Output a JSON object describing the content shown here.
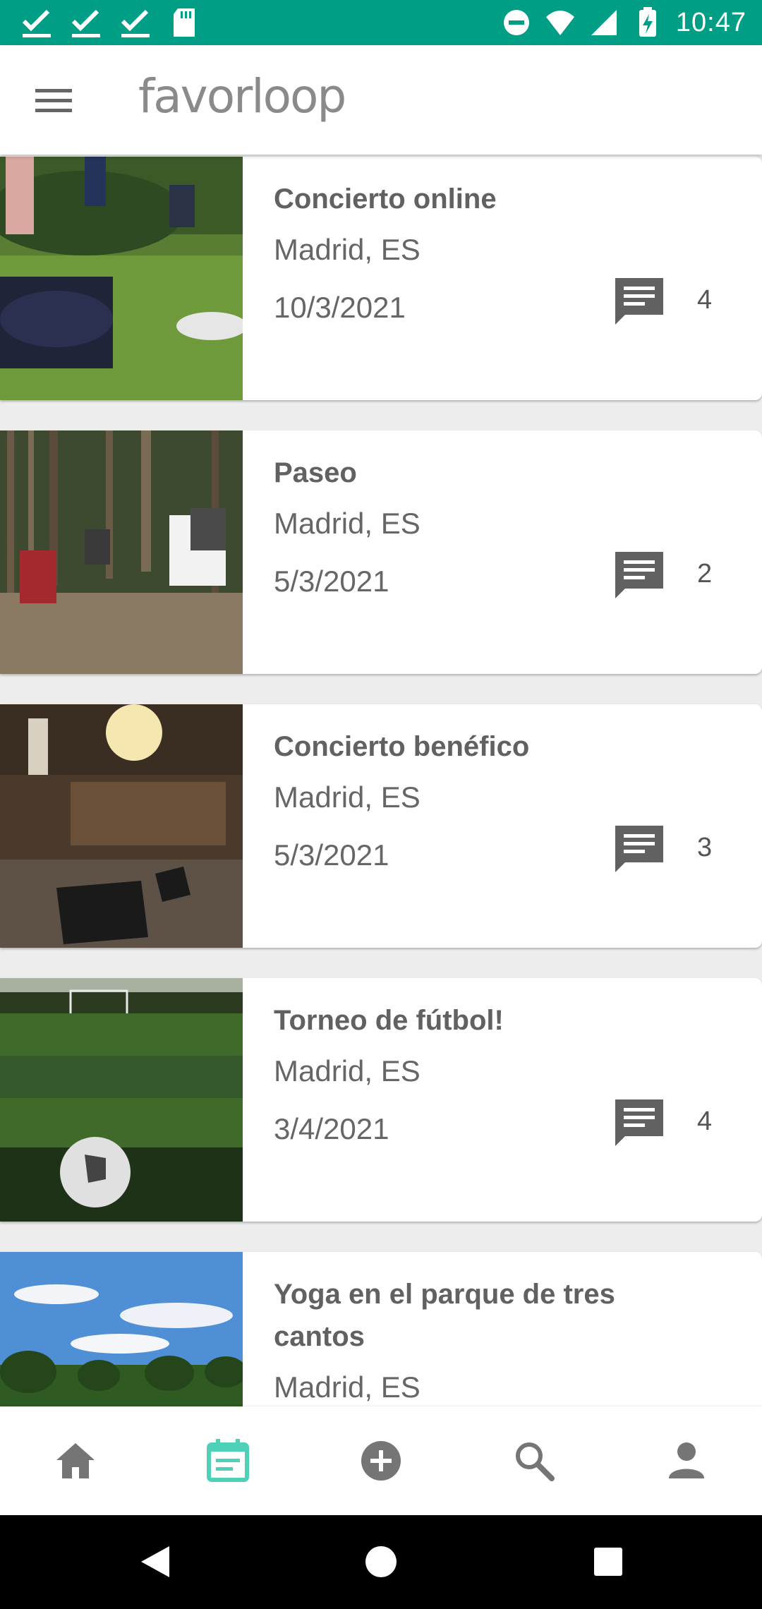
{
  "status_bar": {
    "time": "10:47",
    "left_icons": [
      "check-icon",
      "check-icon",
      "check-icon",
      "sd-card-icon"
    ],
    "right_icons": [
      "do-not-disturb-icon",
      "wifi-icon",
      "signal-icon",
      "battery-charging-icon"
    ]
  },
  "app_bar": {
    "logo": "favorloop",
    "menu_icon": "menu-icon"
  },
  "events": [
    {
      "title": "Concierto online",
      "location": "Madrid, ES",
      "date": "10/3/2021",
      "comments": "4"
    },
    {
      "title": "Paseo",
      "location": "Madrid, ES",
      "date": "5/3/2021",
      "comments": "2"
    },
    {
      "title": "Concierto benéfico",
      "location": "Madrid, ES",
      "date": "5/3/2021",
      "comments": "3"
    },
    {
      "title": "Torneo de fútbol!",
      "location": "Madrid, ES",
      "date": "3/4/2021",
      "comments": "4"
    },
    {
      "title": "Yoga en el parque de tres cantos",
      "location": "Madrid, ES"
    }
  ],
  "bottom_nav": {
    "items": [
      "home-icon",
      "calendar-icon",
      "add-circle-icon",
      "search-icon",
      "person-icon"
    ],
    "active": "calendar-icon",
    "active_color": "#4fd1b8",
    "inactive_color": "#757575"
  },
  "colors": {
    "status_bar": "#009e85",
    "card_text": "#666666",
    "background": "#ededed"
  }
}
